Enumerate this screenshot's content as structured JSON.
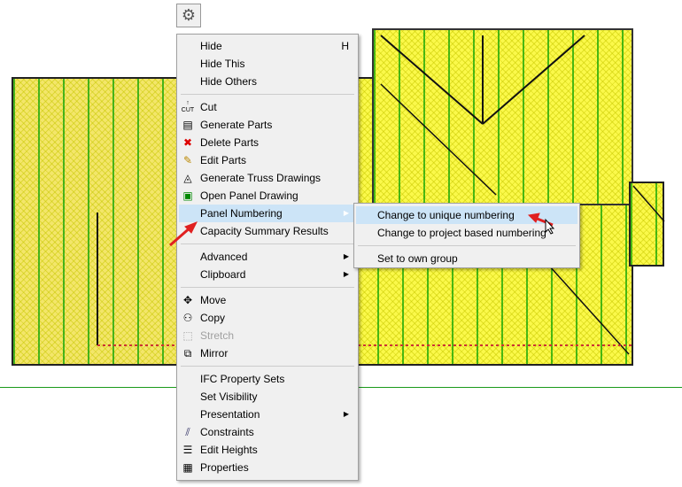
{
  "toolbar": {
    "settings_icon": "gear-icon"
  },
  "menu": {
    "group1": [
      {
        "label": "Hide",
        "shortcut": "H"
      },
      {
        "label": "Hide This"
      },
      {
        "label": "Hide Others"
      }
    ],
    "group2": [
      {
        "label": "Cut",
        "icon": "cut-icon"
      },
      {
        "label": "Generate Parts",
        "icon": "generate-parts-icon"
      },
      {
        "label": "Delete Parts",
        "icon": "delete-parts-icon"
      },
      {
        "label": "Edit Parts",
        "icon": "edit-parts-icon"
      },
      {
        "label": "Generate Truss Drawings",
        "icon": "truss-drawing-icon"
      },
      {
        "label": "Open Panel Drawing",
        "icon": "panel-drawing-icon"
      },
      {
        "label": "Panel Numbering"
      },
      {
        "label": "Capacity Summary Results"
      }
    ],
    "group3": [
      {
        "label": "Advanced"
      },
      {
        "label": "Clipboard"
      }
    ],
    "group4": [
      {
        "label": "Move",
        "icon": "move-icon"
      },
      {
        "label": "Copy",
        "icon": "copy-icon"
      },
      {
        "label": "Stretch",
        "icon": "stretch-icon",
        "disabled": true
      },
      {
        "label": "Mirror",
        "icon": "mirror-icon"
      }
    ],
    "group5": [
      {
        "label": "IFC Property Sets"
      },
      {
        "label": "Set Visibility"
      },
      {
        "label": "Presentation"
      },
      {
        "label": "Constraints",
        "icon": "constraints-icon"
      },
      {
        "label": "Edit Heights",
        "icon": "edit-heights-icon"
      },
      {
        "label": "Properties",
        "icon": "properties-icon"
      }
    ]
  },
  "submenu": {
    "items": [
      {
        "label": "Change to unique numbering"
      },
      {
        "label": "Change to project based numbering"
      },
      {
        "label": "Set to own group"
      }
    ]
  },
  "colors": {
    "highlight": "#cce4f7",
    "annotation_arrow": "#e02020"
  }
}
